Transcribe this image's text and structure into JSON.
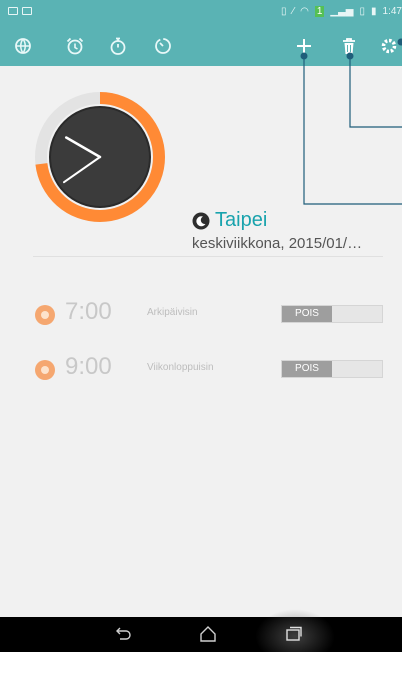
{
  "status_bar": {
    "time": "1:47",
    "icons": [
      "gallery-notification-icon",
      "image-notification-icon",
      "vibrate-icon",
      "mute-icon",
      "wifi-icon",
      "data-icon",
      "signal-icon",
      "sim-icon",
      "battery-icon"
    ]
  },
  "toolbar": {
    "icons": [
      "world-clock-icon",
      "alarm-icon",
      "stopwatch-icon",
      "timer-icon",
      "add-icon",
      "delete-icon",
      "settings-icon"
    ]
  },
  "world_clock": {
    "city": "Taipei",
    "subtitle": "keskiviikkona, 2015/01/…",
    "hour_hand_deg": 300,
    "minute_hand_deg": 235,
    "accent_color": "#ff8a35"
  },
  "alarms": [
    {
      "time": "7:00",
      "label": "Arkipäivisin",
      "toggle": "POIS"
    },
    {
      "time": "9:00",
      "label": "Viikonloppuisin",
      "toggle": "POIS"
    }
  ],
  "nav": {
    "icons": [
      "back-icon",
      "home-icon",
      "recent-apps-icon"
    ]
  },
  "colors": {
    "toolbar": "#5ab3b4",
    "accent_orange": "#ff8a35",
    "city_teal": "#19a3ad"
  }
}
